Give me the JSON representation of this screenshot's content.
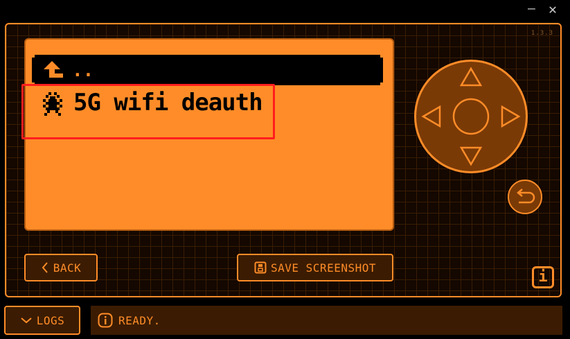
{
  "window": {
    "minimize_icon": "minimize-icon",
    "close_icon": "close-icon"
  },
  "device": {
    "version": "1.3.3"
  },
  "file_browser": {
    "parent_label": "..",
    "items": [
      {
        "label": "5G wifi deauth",
        "icon": "bug-icon"
      }
    ]
  },
  "buttons": {
    "back_label": "BACK",
    "save_screenshot_label": "SAVE SCREENSHOT",
    "logs_label": "LOGS",
    "info_label": "i"
  },
  "status": {
    "text": "READY."
  },
  "colors": {
    "accent": "#ff8c28",
    "screen_bg": "#ff8c28",
    "highlight": "#ff1e1e",
    "background": "#140800"
  }
}
